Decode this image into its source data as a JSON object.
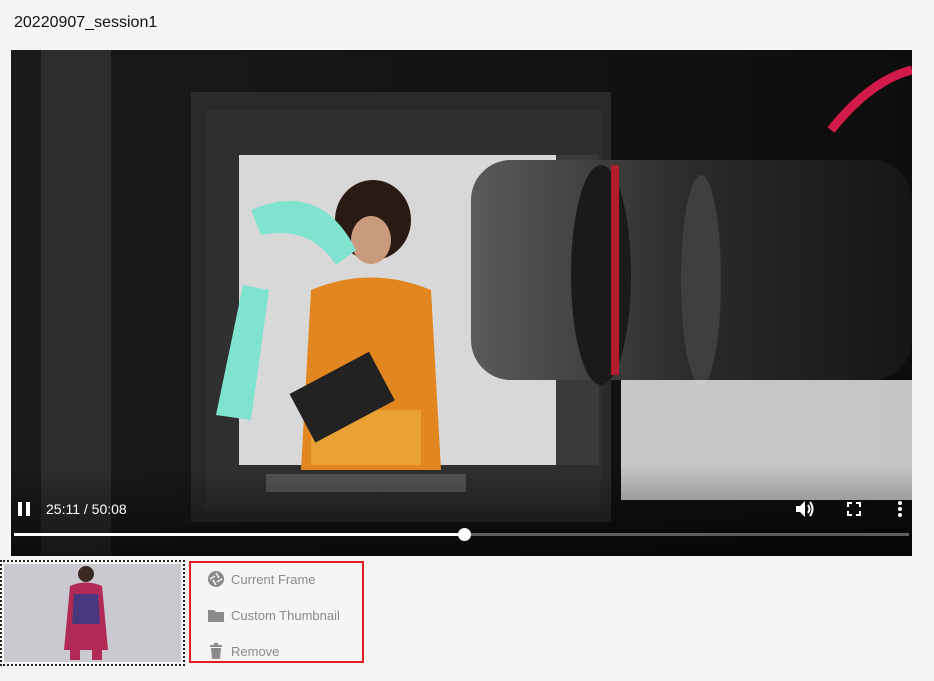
{
  "session_title": "20220907_session1",
  "player": {
    "time_display": "25:11 / 50:08",
    "progress_fraction": 0.503,
    "icons": {
      "play_pause": "pause-icon",
      "volume": "volume-icon",
      "fullscreen": "fullscreen-icon",
      "more": "more-vert-icon"
    }
  },
  "thumbnail_menu": {
    "items": [
      {
        "label": "Current Frame",
        "icon": "aperture-icon"
      },
      {
        "label": "Custom Thumbnail",
        "icon": "folder-icon"
      },
      {
        "label": "Remove",
        "icon": "trash-icon"
      }
    ]
  },
  "colors": {
    "menu_border": "#e0201e",
    "menu_text": "#8a8a8a"
  }
}
